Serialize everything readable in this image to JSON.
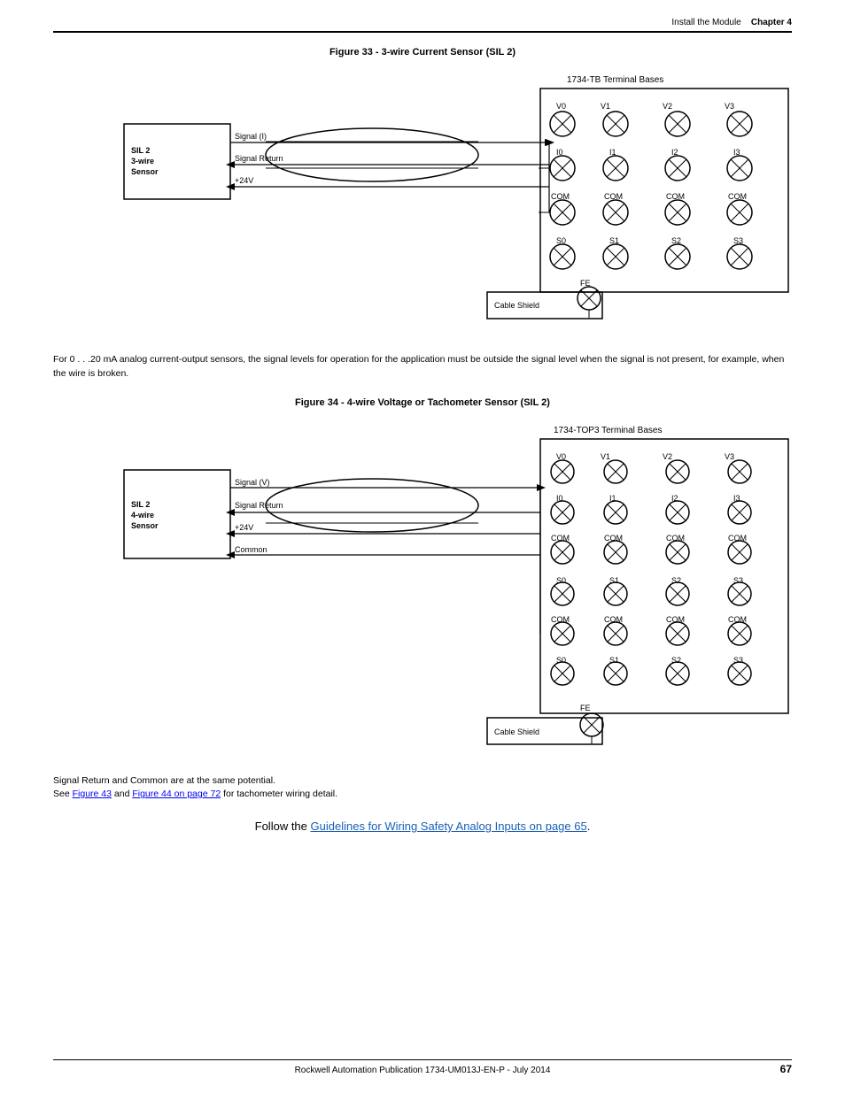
{
  "header": {
    "left": "Install the Module",
    "chapter": "Chapter 4"
  },
  "figure33": {
    "title": "Figure 33 - 3-wire Current Sensor (SIL 2)",
    "terminal_label": "1734-TB Terminal Bases",
    "sensor_label": "SIL 2\n3-wire\nSensor",
    "signal_i": "Signal (I)",
    "signal_return": "Signal Return",
    "plus24v": "+24V",
    "cable_shield": "Cable Shield",
    "fe": "FE"
  },
  "figure34": {
    "title": "Figure 34 - 4-wire Voltage or Tachometer Sensor (SIL 2)",
    "terminal_label": "1734-TOP3 Terminal Bases",
    "sensor_label": "SIL 2\n4-wire\nSensor",
    "signal_v": "Signal (V)",
    "signal_return": "Signal Return",
    "plus24v": "+24V",
    "common": "Common",
    "cable_shield": "Cable Shield",
    "fe": "FE"
  },
  "body_text": "For 0 . . .20 mA analog current-output sensors, the signal levels for operation for the application must be outside the signal level when the signal is not present, for example, when the wire is broken.",
  "footer_notes": {
    "line1": "Signal Return and Common are at the same potential.",
    "line2_pre": "See ",
    "link1": "Figure 43",
    "line2_mid": " and ",
    "link2": "Figure 44 on page 72",
    "line2_post": " for tachometer wiring detail."
  },
  "follow_text": {
    "pre": "Follow the ",
    "link": "Guidelines for Wiring Safety Analog Inputs on page 65",
    "post": "."
  },
  "page_footer": {
    "text": "Rockwell Automation Publication 1734-UM013J-EN-P - July 2014"
  },
  "page_number": "67"
}
